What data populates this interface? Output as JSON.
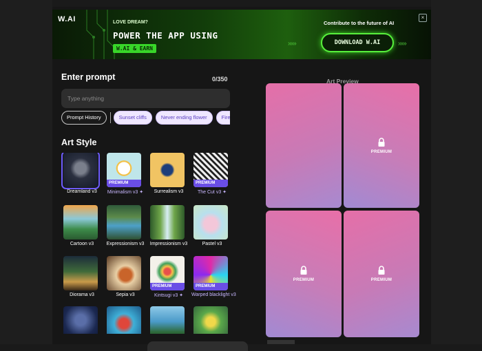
{
  "banner": {
    "logo_text": "W.AI",
    "kicker": "LOVE DREAM?",
    "headline": "POWER THE APP USING",
    "earn_chip": "W.AI & EARN",
    "contribute": "Contribute to the future of AI",
    "download_label": "DOWNLOAD W.AI",
    "close_icon": "×",
    "arrow_left": "›››››",
    "arrow_right": "›››››",
    "accent": "#57ef3c"
  },
  "prompt": {
    "title": "Enter prompt",
    "count": "0/350",
    "placeholder": "Type anything",
    "history_label": "Prompt History",
    "suggestions": [
      "Sunset cliffs",
      "Never ending flower",
      "Fire and w"
    ]
  },
  "art_style": {
    "title": "Art Style",
    "premium_tag": "PREMIUM",
    "styles": [
      {
        "label": "Dreamland v3"
      },
      {
        "label": "Minimalism v3 ✦"
      },
      {
        "label": "Surrealism v3"
      },
      {
        "label": "The Cut v3 ✦"
      },
      {
        "label": "Cartoon v3"
      },
      {
        "label": "Expressionism v3"
      },
      {
        "label": "Impressionism v3"
      },
      {
        "label": "Pastel v3"
      },
      {
        "label": "Diorama v3"
      },
      {
        "label": "Sepia v3"
      },
      {
        "label": "Kintsugi v3 ✦"
      },
      {
        "label": "Warped blacklight v3"
      },
      {
        "label": ""
      },
      {
        "label": ""
      },
      {
        "label": ""
      },
      {
        "label": ""
      }
    ]
  },
  "preview": {
    "title": "Art Preview",
    "premium_label": "PREMIUM",
    "card_colors": [
      "#e56fa8",
      "#a78ad0"
    ]
  }
}
